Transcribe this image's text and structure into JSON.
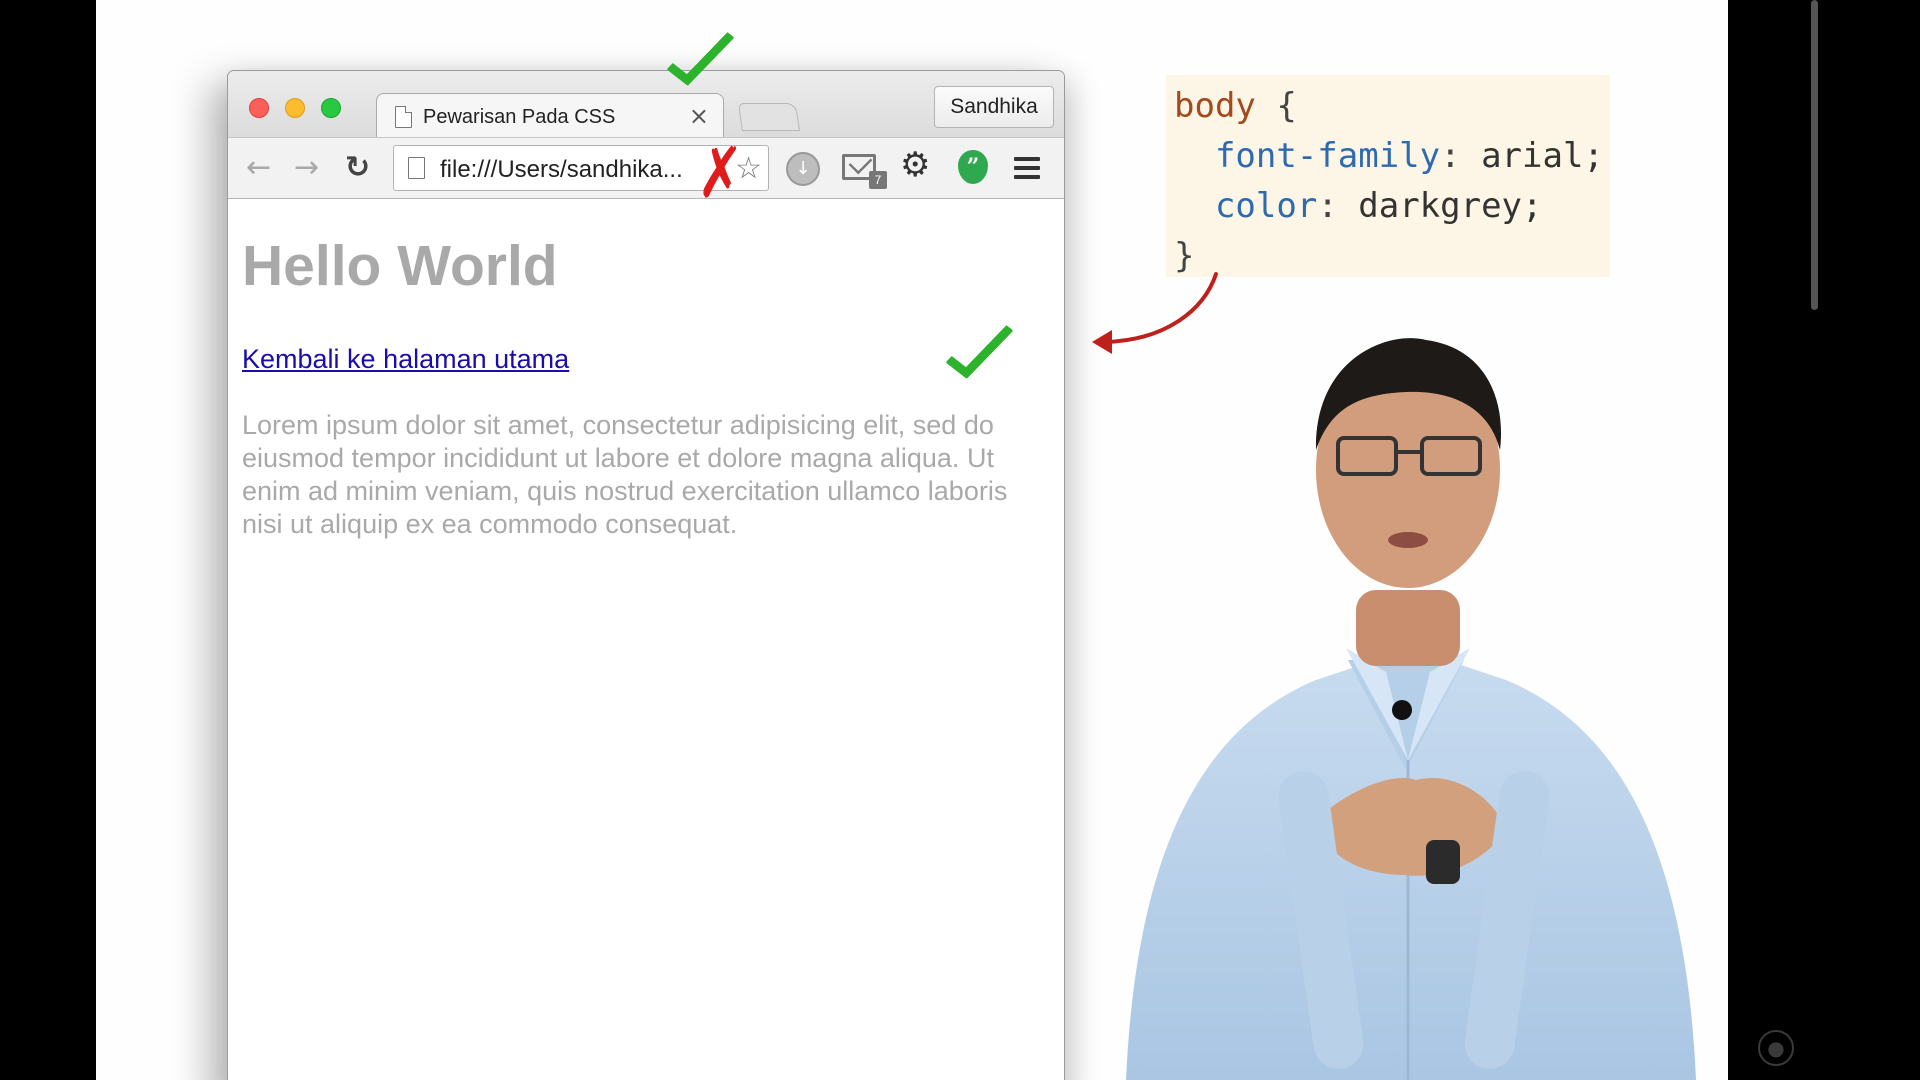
{
  "browser": {
    "tab_title": "Pewarisan Pada CSS",
    "tab_close": "×",
    "profile_name": "Sandhika",
    "url": "file:///Users/sandhika...",
    "mail_badge": "7"
  },
  "page": {
    "heading": "Hello World",
    "link_text": "Kembali ke halaman utama",
    "paragraph": "Lorem ipsum dolor sit amet, consectetur adipisicing elit, sed do eiusmod tempor incididunt ut labore et dolore magna aliqua. Ut enim ad minim veniam, quis nostrud exercitation ullamco laboris nisi ut aliquip ex ea commodo consequat."
  },
  "code": {
    "selector": "body",
    "open_brace": " {",
    "prop1": "font-family",
    "val1": " arial;",
    "prop2": "color",
    "val2": " darkgrey;",
    "close_brace": "}"
  },
  "icons": {
    "back": "arrow-left-icon",
    "forward": "arrow-right-icon",
    "reload": "reload-icon",
    "bookmark": "star-icon",
    "menu": "hamburger-menu-icon",
    "check": "checkmark-icon",
    "cross": "cross-icon"
  },
  "colors": {
    "check_green": "#2db32b",
    "cross_red": "#e01b1b",
    "heading_grey": "#a9a9a9",
    "link_blue": "#1a0dab",
    "code_bg": "#fdf6e6"
  }
}
